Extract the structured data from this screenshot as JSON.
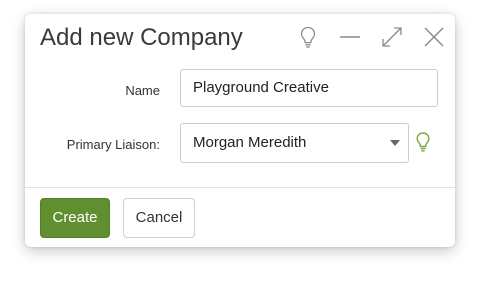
{
  "dialog": {
    "title": "Add new Company",
    "header_buttons": {
      "tip_icon": "lightbulb-icon",
      "minimize_icon": "minimize-icon",
      "maximize_icon": "expand-icon",
      "close_icon": "close-icon"
    }
  },
  "form": {
    "name_label": "Name",
    "name_value": "Playground Creative",
    "liaison_label": "Primary Liaison:",
    "liaison_value": "Morgan Meredith",
    "liaison_tip_icon": "lightbulb-icon"
  },
  "footer": {
    "create_label": "Create",
    "cancel_label": "Cancel"
  },
  "colors": {
    "primary_button": "#5f8f2f",
    "tip_icon_green": "#7aa83a",
    "header_icon": "#8a8a8a"
  }
}
